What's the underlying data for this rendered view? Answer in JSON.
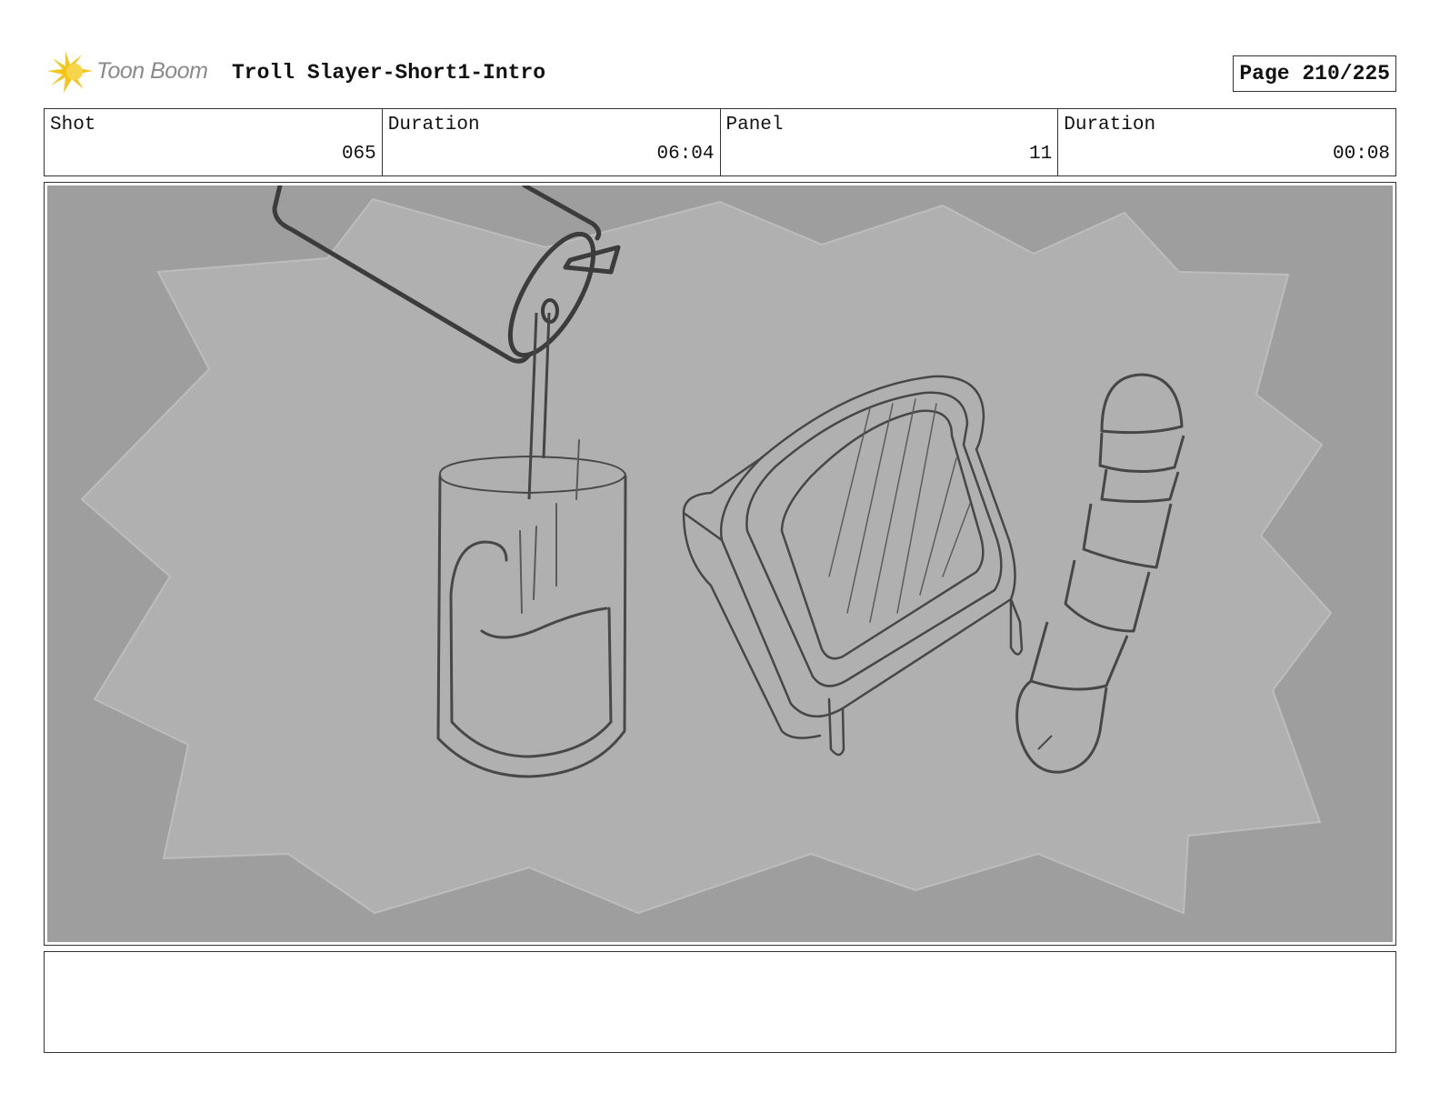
{
  "header": {
    "brand": "Toon Boom",
    "project_title": "Troll Slayer-Short1-Intro",
    "page_label": "Page 210/225"
  },
  "info": [
    {
      "label": "Shot",
      "value": "065"
    },
    {
      "label": "Duration",
      "value": "06:04"
    },
    {
      "label": "Panel",
      "value": "11"
    },
    {
      "label": "Duration",
      "value": "00:08"
    }
  ],
  "panel": {
    "icons": [
      "milk-carton-icon",
      "glass-of-milk-icon",
      "toast-sandwich-icon",
      "sliced-sausage-icon"
    ]
  },
  "notes": {
    "text": ""
  },
  "colors": {
    "logo_yellow": "#f5c518",
    "panel_background": "#9e9e9e",
    "panel_splash": "#b0b0b0",
    "sketch_line": "#4a4a4a"
  }
}
